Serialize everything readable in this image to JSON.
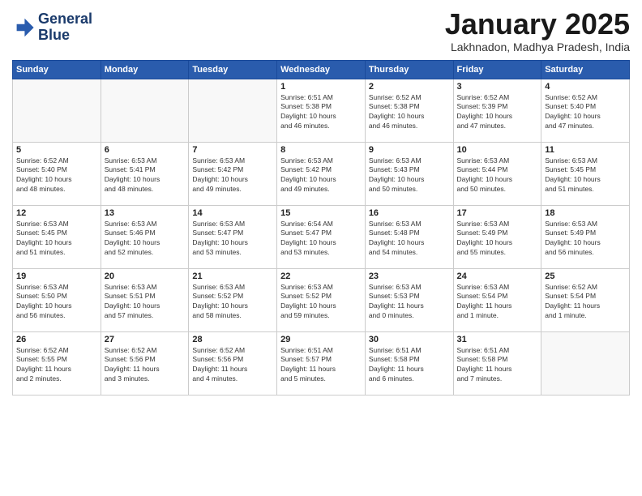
{
  "logo": {
    "text_line1": "General",
    "text_line2": "Blue"
  },
  "title": "January 2025",
  "subtitle": "Lakhnadon, Madhya Pradesh, India",
  "days_of_week": [
    "Sunday",
    "Monday",
    "Tuesday",
    "Wednesday",
    "Thursday",
    "Friday",
    "Saturday"
  ],
  "weeks": [
    [
      {
        "day": "",
        "info": ""
      },
      {
        "day": "",
        "info": ""
      },
      {
        "day": "",
        "info": ""
      },
      {
        "day": "1",
        "info": "Sunrise: 6:51 AM\nSunset: 5:38 PM\nDaylight: 10 hours\nand 46 minutes."
      },
      {
        "day": "2",
        "info": "Sunrise: 6:52 AM\nSunset: 5:38 PM\nDaylight: 10 hours\nand 46 minutes."
      },
      {
        "day": "3",
        "info": "Sunrise: 6:52 AM\nSunset: 5:39 PM\nDaylight: 10 hours\nand 47 minutes."
      },
      {
        "day": "4",
        "info": "Sunrise: 6:52 AM\nSunset: 5:40 PM\nDaylight: 10 hours\nand 47 minutes."
      }
    ],
    [
      {
        "day": "5",
        "info": "Sunrise: 6:52 AM\nSunset: 5:40 PM\nDaylight: 10 hours\nand 48 minutes."
      },
      {
        "day": "6",
        "info": "Sunrise: 6:53 AM\nSunset: 5:41 PM\nDaylight: 10 hours\nand 48 minutes."
      },
      {
        "day": "7",
        "info": "Sunrise: 6:53 AM\nSunset: 5:42 PM\nDaylight: 10 hours\nand 49 minutes."
      },
      {
        "day": "8",
        "info": "Sunrise: 6:53 AM\nSunset: 5:42 PM\nDaylight: 10 hours\nand 49 minutes."
      },
      {
        "day": "9",
        "info": "Sunrise: 6:53 AM\nSunset: 5:43 PM\nDaylight: 10 hours\nand 50 minutes."
      },
      {
        "day": "10",
        "info": "Sunrise: 6:53 AM\nSunset: 5:44 PM\nDaylight: 10 hours\nand 50 minutes."
      },
      {
        "day": "11",
        "info": "Sunrise: 6:53 AM\nSunset: 5:45 PM\nDaylight: 10 hours\nand 51 minutes."
      }
    ],
    [
      {
        "day": "12",
        "info": "Sunrise: 6:53 AM\nSunset: 5:45 PM\nDaylight: 10 hours\nand 51 minutes."
      },
      {
        "day": "13",
        "info": "Sunrise: 6:53 AM\nSunset: 5:46 PM\nDaylight: 10 hours\nand 52 minutes."
      },
      {
        "day": "14",
        "info": "Sunrise: 6:53 AM\nSunset: 5:47 PM\nDaylight: 10 hours\nand 53 minutes."
      },
      {
        "day": "15",
        "info": "Sunrise: 6:54 AM\nSunset: 5:47 PM\nDaylight: 10 hours\nand 53 minutes."
      },
      {
        "day": "16",
        "info": "Sunrise: 6:53 AM\nSunset: 5:48 PM\nDaylight: 10 hours\nand 54 minutes."
      },
      {
        "day": "17",
        "info": "Sunrise: 6:53 AM\nSunset: 5:49 PM\nDaylight: 10 hours\nand 55 minutes."
      },
      {
        "day": "18",
        "info": "Sunrise: 6:53 AM\nSunset: 5:49 PM\nDaylight: 10 hours\nand 56 minutes."
      }
    ],
    [
      {
        "day": "19",
        "info": "Sunrise: 6:53 AM\nSunset: 5:50 PM\nDaylight: 10 hours\nand 56 minutes."
      },
      {
        "day": "20",
        "info": "Sunrise: 6:53 AM\nSunset: 5:51 PM\nDaylight: 10 hours\nand 57 minutes."
      },
      {
        "day": "21",
        "info": "Sunrise: 6:53 AM\nSunset: 5:52 PM\nDaylight: 10 hours\nand 58 minutes."
      },
      {
        "day": "22",
        "info": "Sunrise: 6:53 AM\nSunset: 5:52 PM\nDaylight: 10 hours\nand 59 minutes."
      },
      {
        "day": "23",
        "info": "Sunrise: 6:53 AM\nSunset: 5:53 PM\nDaylight: 11 hours\nand 0 minutes."
      },
      {
        "day": "24",
        "info": "Sunrise: 6:53 AM\nSunset: 5:54 PM\nDaylight: 11 hours\nand 1 minute."
      },
      {
        "day": "25",
        "info": "Sunrise: 6:52 AM\nSunset: 5:54 PM\nDaylight: 11 hours\nand 1 minute."
      }
    ],
    [
      {
        "day": "26",
        "info": "Sunrise: 6:52 AM\nSunset: 5:55 PM\nDaylight: 11 hours\nand 2 minutes."
      },
      {
        "day": "27",
        "info": "Sunrise: 6:52 AM\nSunset: 5:56 PM\nDaylight: 11 hours\nand 3 minutes."
      },
      {
        "day": "28",
        "info": "Sunrise: 6:52 AM\nSunset: 5:56 PM\nDaylight: 11 hours\nand 4 minutes."
      },
      {
        "day": "29",
        "info": "Sunrise: 6:51 AM\nSunset: 5:57 PM\nDaylight: 11 hours\nand 5 minutes."
      },
      {
        "day": "30",
        "info": "Sunrise: 6:51 AM\nSunset: 5:58 PM\nDaylight: 11 hours\nand 6 minutes."
      },
      {
        "day": "31",
        "info": "Sunrise: 6:51 AM\nSunset: 5:58 PM\nDaylight: 11 hours\nand 7 minutes."
      },
      {
        "day": "",
        "info": ""
      }
    ]
  ]
}
